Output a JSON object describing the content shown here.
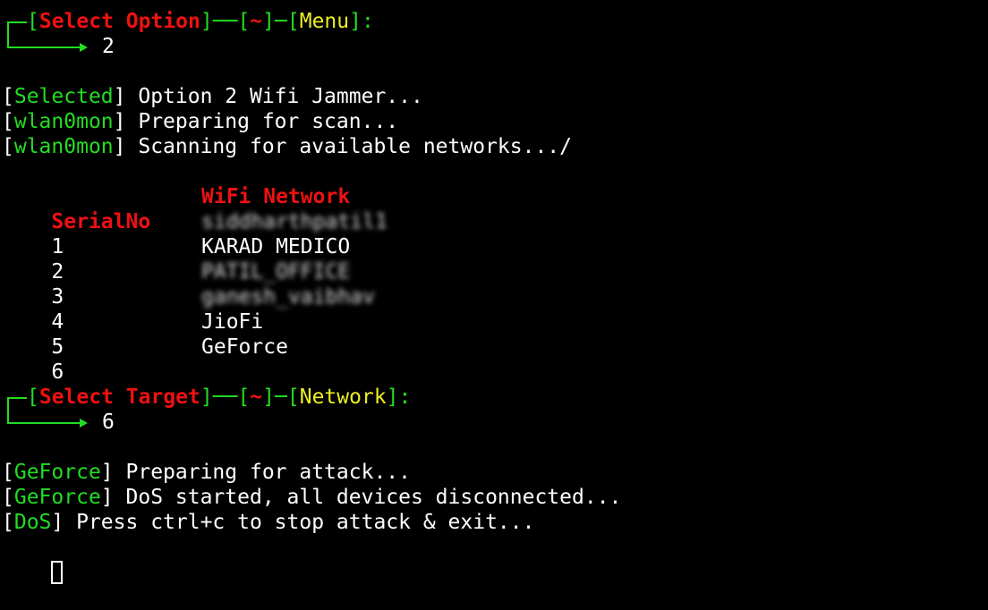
{
  "prompt1": {
    "open": "[",
    "label": "Select Option",
    "close": "]",
    "dash": "──",
    "tilde_open": "[",
    "tilde": "~",
    "tilde_close": "]",
    "dash2": "─",
    "ctx_open": "[",
    "context": "Menu",
    "ctx_close": "]",
    "colon": ":",
    "answer": "2"
  },
  "log1": [
    {
      "tag": "Selected",
      "message": " Option 2 Wifi Jammer..."
    },
    {
      "tag": "wlan0mon",
      "message": " Preparing for scan..."
    },
    {
      "tag": "wlan0mon",
      "message": " Scanning for available networks.../"
    }
  ],
  "table": {
    "headers": {
      "serial": "SerialNo",
      "network": "WiFi Network"
    },
    "rows": [
      {
        "serial": "1",
        "network": "siddharthpatil1",
        "blurred": true
      },
      {
        "serial": "2",
        "network": "KARAD MEDICO",
        "blurred": false
      },
      {
        "serial": "3",
        "network": "PATIL_OFFICE",
        "blurred": true
      },
      {
        "serial": "4",
        "network": "ganesh_vaibhav",
        "blurred": true
      },
      {
        "serial": "5",
        "network": "JioFi",
        "blurred": false
      },
      {
        "serial": "6",
        "network": "GeForce",
        "blurred": false
      }
    ]
  },
  "prompt2": {
    "open": "[",
    "label": "Select Target",
    "close": "]",
    "dash": "──",
    "tilde_open": "[",
    "tilde": "~",
    "tilde_close": "]",
    "dash2": "─",
    "ctx_open": "[",
    "context": "Network",
    "ctx_close": "]",
    "colon": ":",
    "answer": "6"
  },
  "log2": [
    {
      "tag": "GeForce",
      "message": " Preparing for attack..."
    },
    {
      "tag": "GeForce",
      "message": " DoS started, all devices disconnected..."
    },
    {
      "tag": "DoS",
      "message": " Press ctrl+c to stop attack & exit..."
    }
  ],
  "colors": {
    "background": "#000000",
    "green": "#22dd22",
    "red": "#ee1111",
    "yellow": "#eeee22",
    "white": "#ffffff"
  }
}
